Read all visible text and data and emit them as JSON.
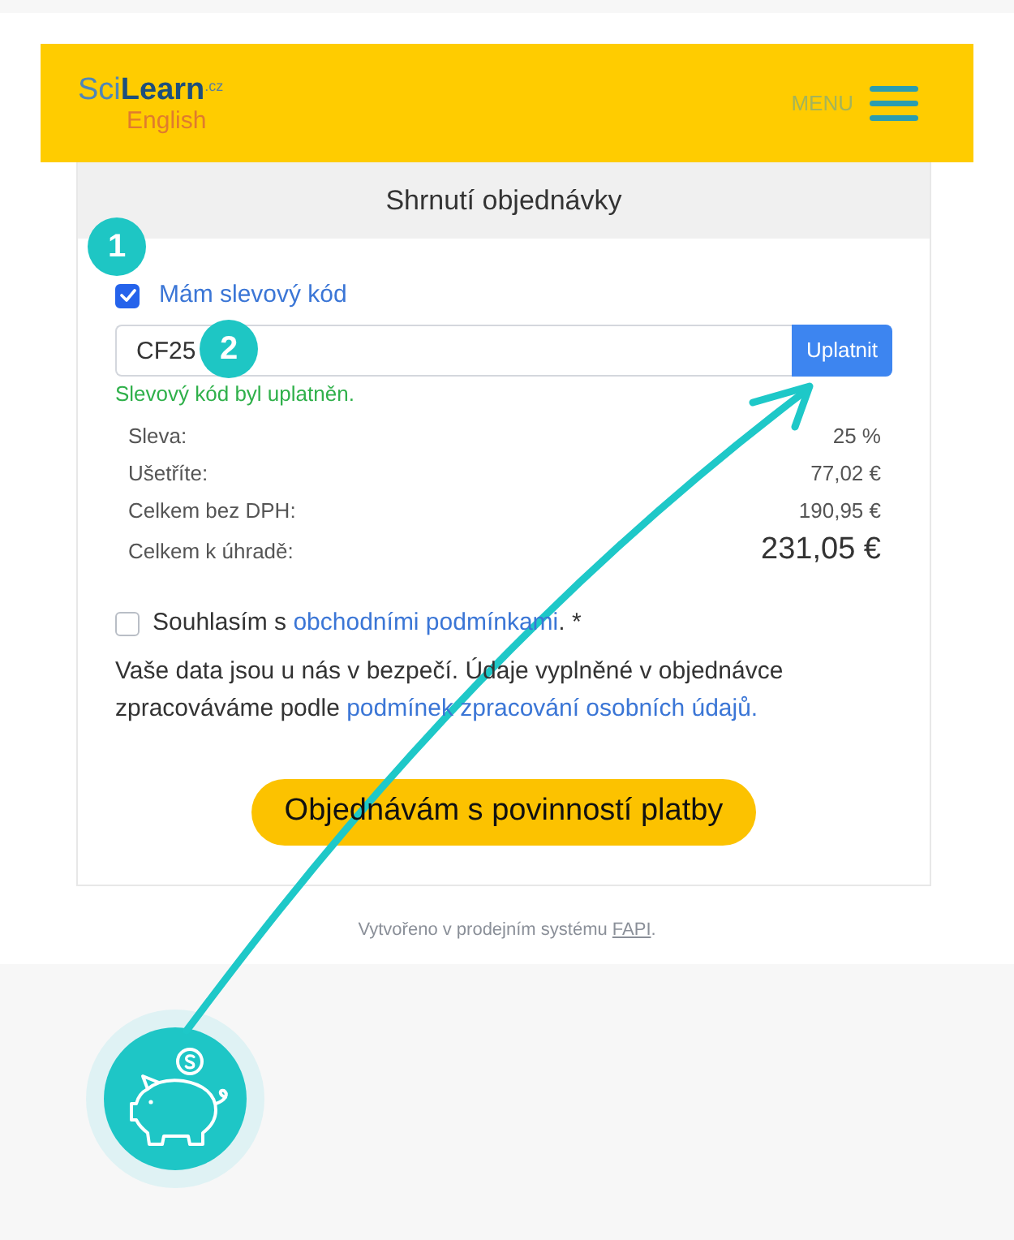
{
  "header": {
    "logo": {
      "wordmark": "Sci**Learn**$^{.cz}$",
      "subtitle": "English"
    },
    "menu": {
      "label": "MENU"
    }
  },
  "order_summary": {
    "title": "Shrnutí objednávky",
    "discount_code": {
      "label": "Mám slevový kód",
      "checked": true
    },
    "coupon": {
      "value": "CF25",
      "button": "Uplatnit",
      "message": "Slevový kód byl uplatněn."
    },
    "rows": [
      {
        "kind": "line",
        "label": "Sleva:",
        "value": "25 %"
      },
      {
        "kind": "line",
        "label": "Ušetříte:",
        "value": "77,02 €"
      },
      {
        "kind": "line",
        "label": "Celkem bez DPH:",
        "value": "190,95 €"
      },
      {
        "kind": "total",
        "label": "Celkem k úhradě:",
        "value": "231,05 €"
      }
    ],
    "terms": {
      "checked": false,
      "text": "Souhlasím s",
      "link": "obchodními podmínkami",
      "suffix": ". *"
    },
    "privacy": {
      "text": "Vaše data jsou u nás v bezpečí. Údaje vyplněné v objednávce zpracováváme podle",
      "link": "podmínek zpracování osobních údajů."
    },
    "submit": "Objednávám s povinností platby"
  },
  "footer": {
    "text": "Vytvořeno v prodejním systému",
    "link": "FAPI",
    "suffix": "."
  },
  "step_badges": [
    {
      "label": "1"
    },
    {
      "label": "2"
    }
  ]
}
